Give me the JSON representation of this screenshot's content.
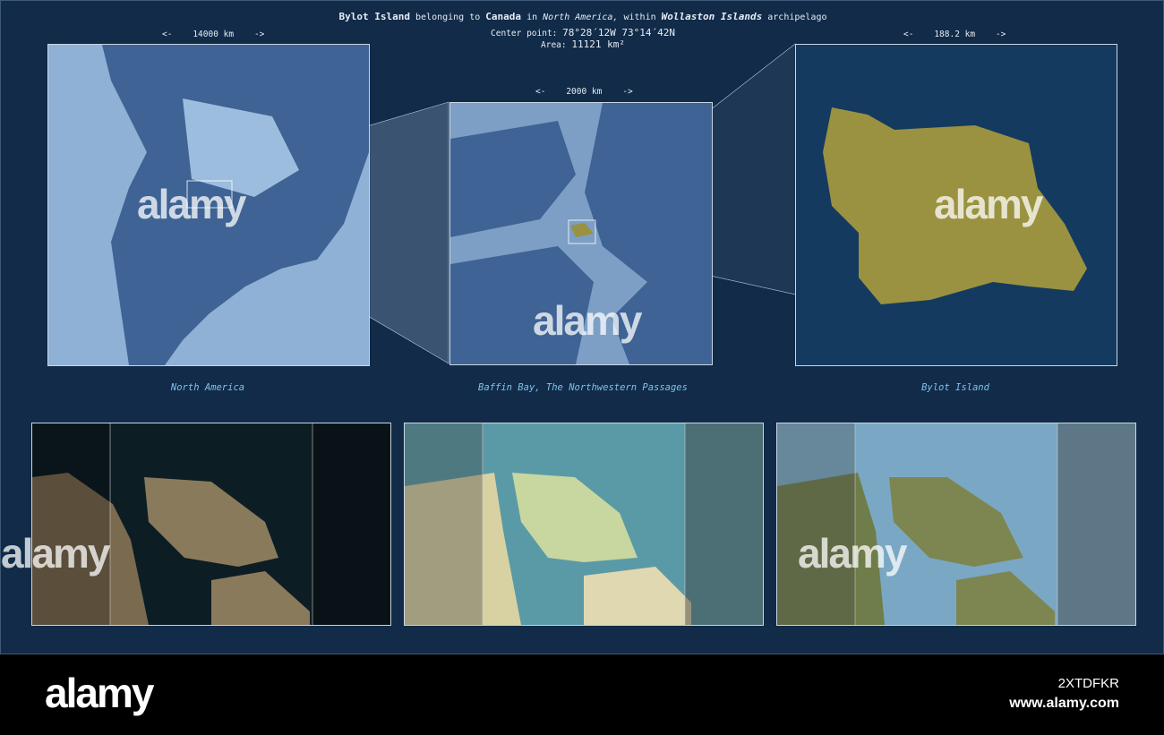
{
  "header": {
    "island": "Bylot Island",
    "belonging": "belonging to",
    "country": "Canada",
    "in": "in",
    "continent": "North America,",
    "within": "within",
    "archipelago_name": "Wollaston Islands",
    "archipelago": "archipelago",
    "center_label": "Center point:",
    "center_value": "78°28´12W  73°14´42N",
    "area_label": "Area:",
    "area_value": "11121 km²"
  },
  "scales": {
    "continent": "<-    14000 km    ->",
    "region": "<-    2000 km    ->",
    "island": "<-    188.2 km    ->"
  },
  "captions": {
    "continent": "North America",
    "region": "Baffin Bay, The Northwestern Passages",
    "island": "Bylot Island"
  },
  "colors": {
    "background": "#112b48",
    "island_fill": "#9a9240",
    "caption": "#7fc3ee"
  },
  "watermark": "alamy",
  "footer": {
    "logo": "alamy",
    "image_id": "2XTDFKR",
    "url": "www.alamy.com"
  }
}
